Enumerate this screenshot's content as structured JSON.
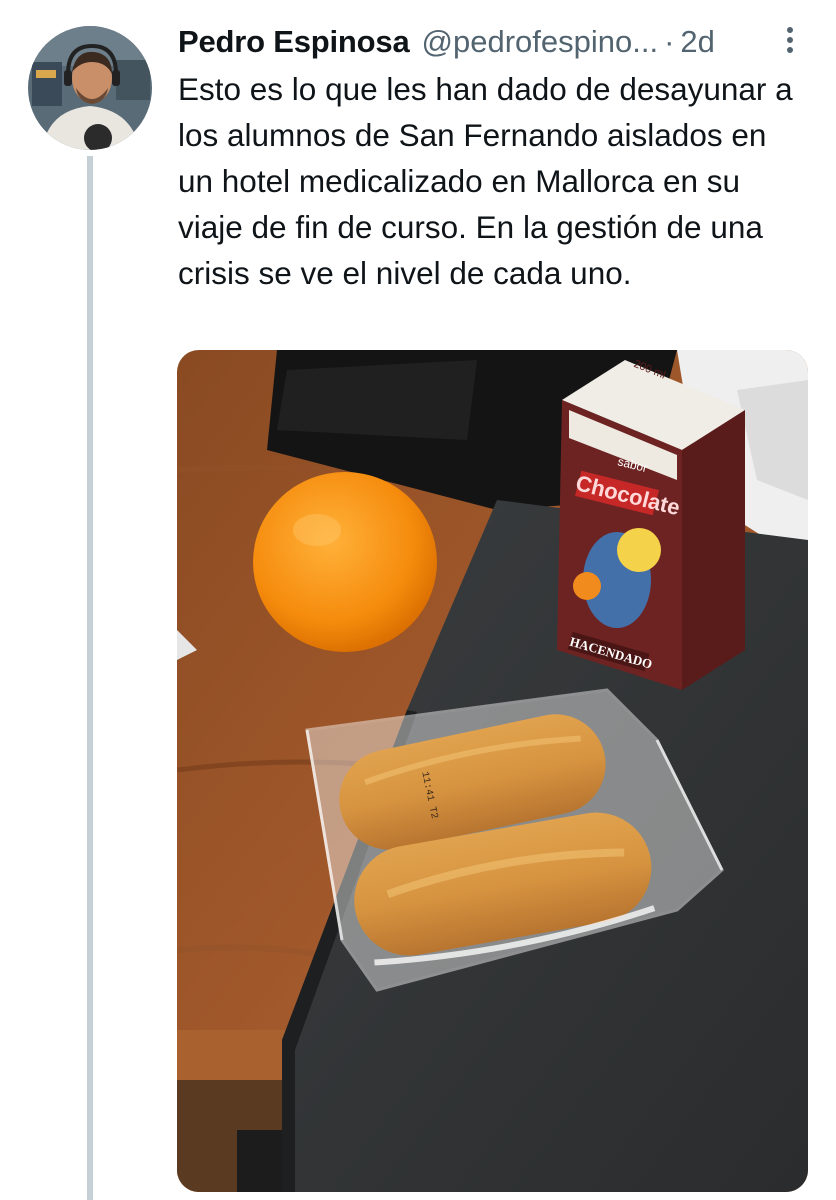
{
  "tweet": {
    "author": {
      "display_name": "Pedro Espinosa",
      "handle": "@pedrofespino..."
    },
    "separator": "·",
    "time": "2d",
    "more_icon": "more-vertical-icon",
    "text": "Esto es lo que les han dado de desayunar a los alumnos de San Fernando aislados en un hotel medicalizado en Mallorca en su viaje de fin de curso. En la gestión de una crisis se ve el nivel de cada uno.",
    "media": {
      "carton_brand": "HACENDADO",
      "carton_flavor": "sabor",
      "carton_product": "Chocolate",
      "carton_volume": "200 ml",
      "wrapper_print": "11:41 T2"
    }
  },
  "colors": {
    "text_primary": "#0f1419",
    "text_secondary": "#536471",
    "thread_line": "#c4cfd6"
  }
}
